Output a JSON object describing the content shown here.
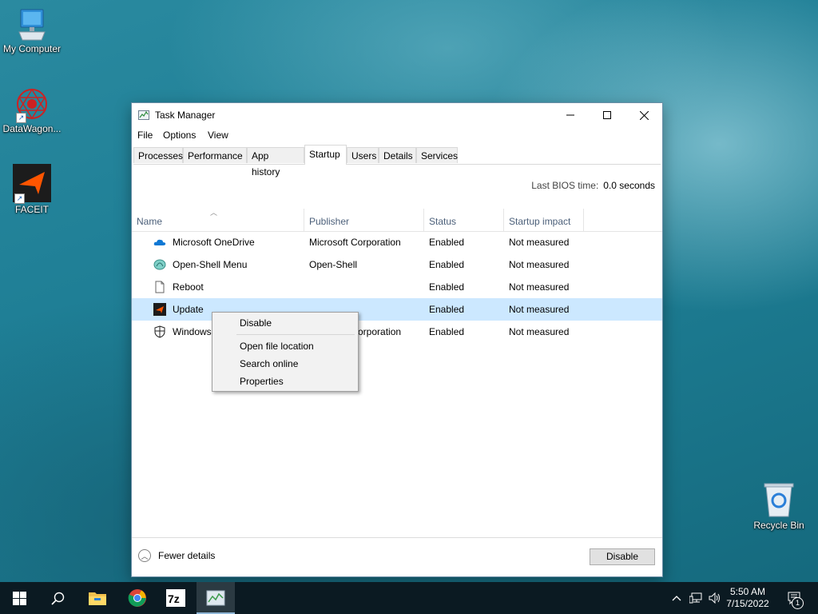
{
  "desktop": {
    "icons": [
      {
        "label": "My Computer",
        "icon": "computer-icon"
      },
      {
        "label": "DataWagon...",
        "icon": "datawagon-icon"
      },
      {
        "label": "FACEIT",
        "icon": "faceit-icon"
      },
      {
        "label": "Recycle Bin",
        "icon": "recycle-bin-icon"
      }
    ]
  },
  "window": {
    "title": "Task Manager",
    "menu": [
      "File",
      "Options",
      "View"
    ],
    "tabs": [
      "Processes",
      "Performance",
      "App history",
      "Startup",
      "Users",
      "Details",
      "Services"
    ],
    "active_tab": "Startup",
    "bios_label": "Last BIOS time:",
    "bios_value": "0.0 seconds",
    "columns": [
      "Name",
      "Publisher",
      "Status",
      "Startup impact"
    ],
    "rows": [
      {
        "name": "Microsoft OneDrive",
        "publisher": "Microsoft Corporation",
        "status": "Enabled",
        "impact": "Not measured",
        "icon": "onedrive-icon"
      },
      {
        "name": "Open-Shell Menu",
        "publisher": "Open-Shell",
        "status": "Enabled",
        "impact": "Not measured",
        "icon": "open-shell-icon"
      },
      {
        "name": "Reboot",
        "publisher": "",
        "status": "Enabled",
        "impact": "Not measured",
        "icon": "file-icon"
      },
      {
        "name": "Update",
        "publisher": "",
        "status": "Enabled",
        "impact": "Not measured",
        "icon": "faceit-icon"
      },
      {
        "name": "Windows",
        "publisher": "orporation",
        "status": "Enabled",
        "impact": "Not measured",
        "icon": "shield-icon"
      }
    ],
    "selected_row": 3,
    "fewer_details": "Fewer details",
    "disable_button": "Disable"
  },
  "context_menu": {
    "items": [
      "Disable",
      "Open file location",
      "Search online",
      "Properties"
    ]
  },
  "taskbar": {
    "apps": [
      "start-icon",
      "search-icon",
      "file-explorer-icon",
      "chrome-icon",
      "7zip-icon",
      "task-manager-icon"
    ],
    "time": "5:50 AM",
    "date": "7/15/2022",
    "notification_count": "1",
    "accent": "#0b1a22"
  }
}
